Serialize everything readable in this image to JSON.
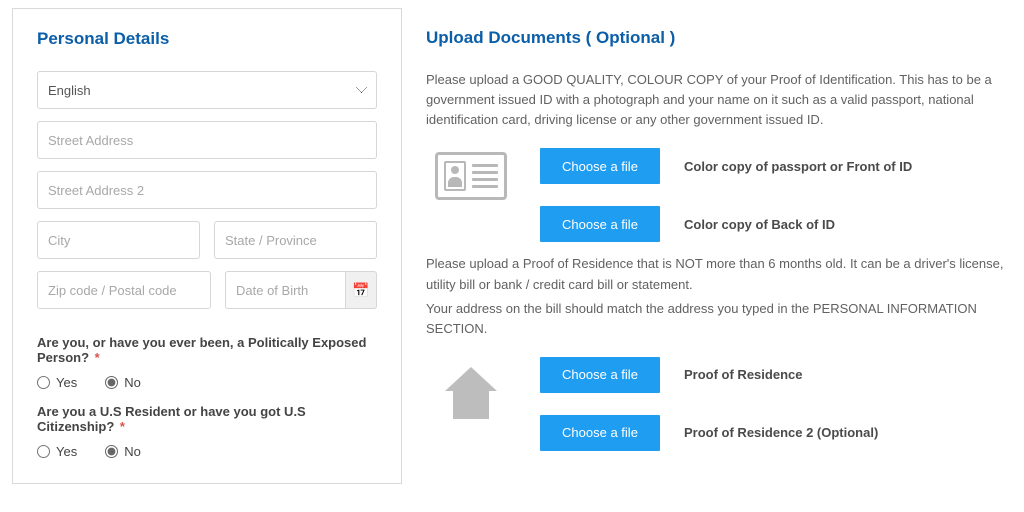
{
  "personal": {
    "heading": "Personal Details",
    "language_value": "English",
    "placeholders": {
      "street1": "Street Address",
      "street2": "Street Address 2",
      "city": "City",
      "state": "State / Province",
      "zip": "Zip code / Postal code",
      "dob": "Date of Birth"
    },
    "q_pep": "Are you, or have you ever been, a Politically Exposed Person?",
    "q_us": "Are you a U.S Resident or have you got U.S Citizenship?",
    "opt_yes": "Yes",
    "opt_no": "No",
    "pep_value": "No",
    "us_value": "No"
  },
  "upload": {
    "heading": "Upload Documents ( Optional )",
    "poi_text": "Please upload a GOOD QUALITY, COLOUR COPY of your Proof of Identification. This has to be a government issued ID with a photograph and your name on it such as a valid passport, national identification card, driving license or any other government issued ID.",
    "por_text1": "Please upload a Proof of Residence that is NOT more than 6 months old. It can be a driver's license, utility bill or bank / credit card bill or statement.",
    "por_text2": "Your address on the bill should match the address you typed in the PERSONAL INFORMATION SECTION.",
    "choose_label": "Choose a file",
    "labels": {
      "id_front": "Color copy of passport or Front of ID",
      "id_back": "Color copy of Back of ID",
      "por1": "Proof of Residence",
      "por2": "Proof of Residence 2 (Optional)"
    }
  }
}
